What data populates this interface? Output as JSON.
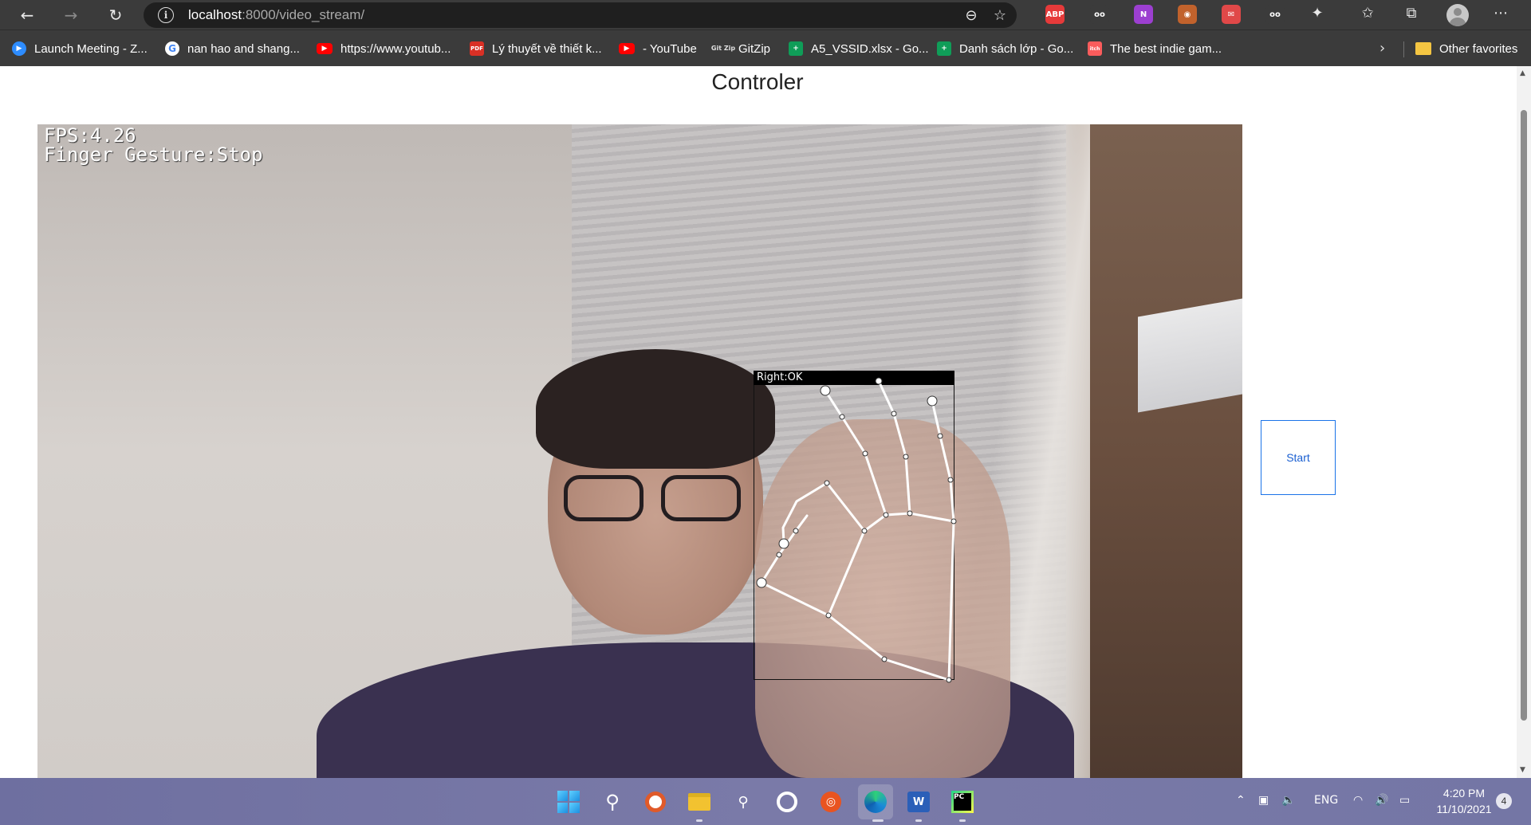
{
  "browser": {
    "url_host": "localhost",
    "url_path": ":8000/video_stream/",
    "nav": {
      "back_icon": "back-arrow-icon",
      "forward_icon": "forward-arrow-icon",
      "refresh_icon": "refresh-icon"
    },
    "extensions": [
      {
        "name": "adblock-plus-icon",
        "label": "ABP",
        "color": "#e63a3a"
      },
      {
        "name": "spy-glasses-icon",
        "label": "oo",
        "color": "#3b3b3b"
      },
      {
        "name": "onenote-icon",
        "label": "N",
        "color": "#9c3fd0"
      },
      {
        "name": "cookie-icon",
        "label": "◉",
        "color": "#c1622c"
      },
      {
        "name": "red-extension-icon",
        "label": "✉",
        "color": "#e04848"
      },
      {
        "name": "reader-icon",
        "label": "oo",
        "color": "#3b3b3b"
      }
    ]
  },
  "favorites": [
    {
      "label": "Launch Meeting - Z...",
      "icon": "zoom"
    },
    {
      "label": "nan hao and shang...",
      "icon": "google"
    },
    {
      "label": "https://www.youtub...",
      "icon": "yt"
    },
    {
      "label": "Lý thuyết về thiết k...",
      "icon": "pdf"
    },
    {
      "label": "- YouTube",
      "icon": "yt"
    },
    {
      "label": "GitZip",
      "icon": "gitzip"
    },
    {
      "label": "A5_VSSID.xlsx - Go...",
      "icon": "sheet"
    },
    {
      "label": "Danh sách lớp - Go...",
      "icon": "sheet"
    },
    {
      "label": "The best indie gam...",
      "icon": "itch"
    }
  ],
  "favorites_other": "Other favorites",
  "page": {
    "title": "Controler",
    "video": {
      "fps_text": "FPS:4.26",
      "gesture_text": "Finger Gesture:Stop",
      "hand_label": "Right:OK"
    },
    "start_button": "Start"
  },
  "taskbar": {
    "language": "ENG",
    "time": "4:20 PM",
    "date": "11/10/2021",
    "notification_count": "4"
  }
}
